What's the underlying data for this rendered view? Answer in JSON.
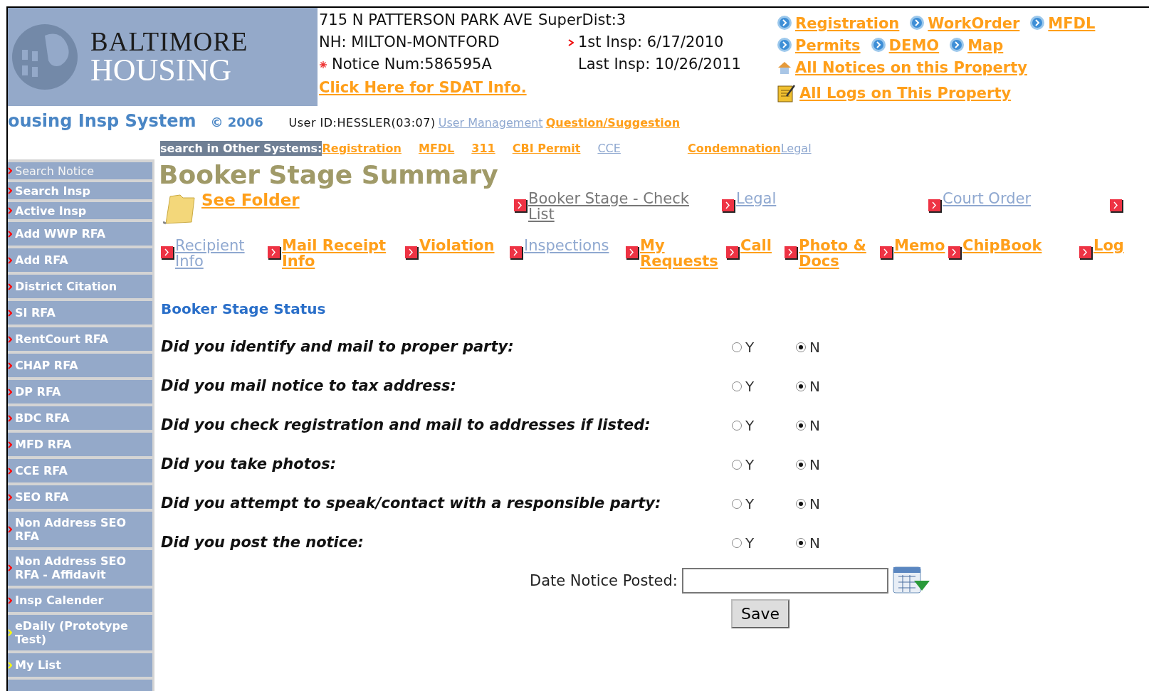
{
  "logo": {
    "line1": "BALTIMORE",
    "line2": "HOUSING"
  },
  "property": {
    "address": "715 N PATTERSON PARK AVE",
    "super_dist": "SuperDist:3",
    "neighborhood": "NH: MILTON-MONTFORD",
    "first_insp": "1st Insp: 6/17/2010",
    "notice_num": "Notice Num:586595A",
    "last_insp": "Last Insp: 10/26/2011",
    "sdat_link": "Click Here for SDAT Info."
  },
  "quick_links": [
    [
      {
        "label": "Registration"
      },
      {
        "label": "WorkOrder"
      },
      {
        "label": "MFDL"
      }
    ],
    [
      {
        "label": "Permits"
      },
      {
        "label": "DEMO"
      },
      {
        "label": "Map"
      }
    ]
  ],
  "notices_link": "All Notices on this Property",
  "logs_link": "All Logs on This Property",
  "app": {
    "title": "ousing Insp System",
    "copyright": "© 2006",
    "user_id": "User ID:HESSLER(03:07)",
    "user_management": "User Management",
    "question": "Question/Suggestion"
  },
  "other_systems": {
    "label": "search in Other Systems:",
    "links": [
      {
        "label": "Registration",
        "visited": false
      },
      {
        "label": "MFDL",
        "visited": false
      },
      {
        "label": "311",
        "visited": false
      },
      {
        "label": "CBI Permit",
        "visited": false
      },
      {
        "label": "CCE",
        "visited": true
      },
      {
        "label": "Condemnation",
        "visited": false
      },
      {
        "label": "Legal",
        "visited": true
      }
    ]
  },
  "sidebar": [
    {
      "label": "Search Notice",
      "visited": true,
      "color": "#ff0000"
    },
    {
      "label": "Search Insp",
      "visited": false,
      "color": "#ff0000"
    },
    {
      "label": "Active Insp",
      "visited": false,
      "color": "#ff0000"
    },
    {
      "label": "Add WWP RFA",
      "visited": false,
      "color": "#ff0000"
    },
    {
      "label": "Add RFA",
      "visited": false,
      "color": "#ff0000"
    },
    {
      "label": "District Citation",
      "visited": false,
      "color": "#ff0000"
    },
    {
      "label": "SI RFA",
      "visited": false,
      "color": "#ff0000"
    },
    {
      "label": "RentCourt RFA",
      "visited": false,
      "color": "#ff0000"
    },
    {
      "label": "CHAP RFA",
      "visited": false,
      "color": "#ff0000"
    },
    {
      "label": "DP RFA",
      "visited": false,
      "color": "#ff0000"
    },
    {
      "label": "BDC RFA",
      "visited": false,
      "color": "#ff0000"
    },
    {
      "label": "MFD RFA",
      "visited": false,
      "color": "#ff0000"
    },
    {
      "label": "CCE RFA",
      "visited": false,
      "color": "#ff0000"
    },
    {
      "label": "SEO RFA",
      "visited": false,
      "color": "#ff0000"
    },
    {
      "label": "Non Address SEO RFA",
      "visited": false,
      "color": "#ff0000"
    },
    {
      "label": "Non Address SEO RFA - Affidavit",
      "visited": false,
      "color": "#ff0000"
    },
    {
      "label": "Insp Calender",
      "visited": false,
      "color": "#ff0000"
    },
    {
      "label": "eDaily (Prototype Test)",
      "visited": false,
      "color": "#ffff00"
    },
    {
      "label": "My List",
      "visited": false,
      "color": "#ffff00"
    }
  ],
  "page_title": "Booker Stage Summary",
  "see_folder": "See Folder",
  "nav_row1": [
    {
      "label": "Booker Stage - Check List",
      "kind": "current"
    },
    {
      "label": "Legal",
      "kind": "visited"
    },
    {
      "label": "Court Order",
      "kind": "visited"
    }
  ],
  "nav_row2": [
    {
      "label": "Recipient Info",
      "kind": "visited"
    },
    {
      "label": "Mail Receipt Info",
      "kind": "link"
    },
    {
      "label": "Violation",
      "kind": "link"
    },
    {
      "label": "Inspections",
      "kind": "visited"
    },
    {
      "label": "My Requests",
      "kind": "link"
    },
    {
      "label": "Call",
      "kind": "link"
    },
    {
      "label": "Photo & Docs",
      "kind": "link"
    },
    {
      "label": "Memo",
      "kind": "link"
    },
    {
      "label": "ChipBook",
      "kind": "link"
    },
    {
      "label": "Log",
      "kind": "link"
    }
  ],
  "status_heading": "Booker Stage Status",
  "questions": [
    {
      "text": "Did you identify and mail to proper party:",
      "options": [
        {
          "label": "Y",
          "selected": false
        },
        {
          "label": "N",
          "selected": true
        }
      ]
    },
    {
      "text": "Did you mail notice to tax address:",
      "options": [
        {
          "label": "Y",
          "selected": false
        },
        {
          "label": "N",
          "selected": true
        }
      ]
    },
    {
      "text": "Did you check registration and mail to addresses if listed:",
      "options": [
        {
          "label": "Y",
          "selected": false
        },
        {
          "label": "N",
          "selected": true
        }
      ]
    },
    {
      "text": "Did you take photos:",
      "options": [
        {
          "label": "Y",
          "selected": false
        },
        {
          "label": "N",
          "selected": true
        }
      ]
    },
    {
      "text": "Did you attempt to speak/contact with a responsible party:",
      "options": [
        {
          "label": "Y",
          "selected": false
        },
        {
          "label": "N",
          "selected": true
        }
      ]
    },
    {
      "text": "Did you post the notice:",
      "options": [
        {
          "label": "Y",
          "selected": false
        },
        {
          "label": "N",
          "selected": true
        }
      ]
    }
  ],
  "date_label": "Date Notice Posted:",
  "save": "Save"
}
